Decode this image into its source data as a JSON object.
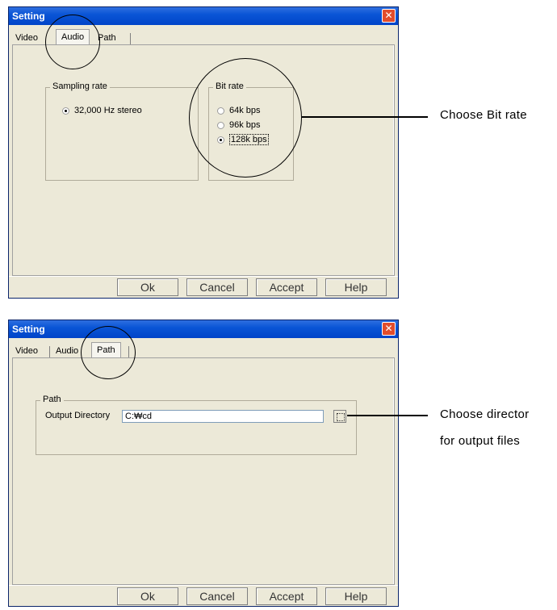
{
  "dialog1": {
    "title": "Setting",
    "close_glyph": "✕",
    "tabs": [
      "Video",
      "Audio",
      "Path"
    ],
    "active_tab": "Audio",
    "sampling_group": {
      "label": "Sampling rate",
      "options": [
        {
          "label": "32,000 Hz stereo",
          "checked": true
        }
      ]
    },
    "bitrate_group": {
      "label": "Bit rate",
      "options": [
        {
          "label": "64k bps",
          "checked": false
        },
        {
          "label": "96k bps",
          "checked": false
        },
        {
          "label": "128k bps",
          "checked": true
        }
      ]
    },
    "buttons": {
      "ok": "Ok",
      "cancel": "Cancel",
      "accept": "Accept",
      "help": "Help"
    }
  },
  "dialog2": {
    "title": "Setting",
    "close_glyph": "✕",
    "tabs": [
      "Video",
      "Audio",
      "Path"
    ],
    "active_tab": "Path",
    "path_group": {
      "label": "Path",
      "output_label": "Output Directory",
      "output_value": "C:₩cd"
    },
    "buttons": {
      "ok": "Ok",
      "cancel": "Cancel",
      "accept": "Accept",
      "help": "Help"
    }
  },
  "callouts": {
    "bitrate": "Choose Bit rate",
    "directory_line1": "Choose director",
    "directory_line2": "for output files"
  },
  "icons": {
    "close": "close-icon",
    "browse": "browse-folder-icon"
  }
}
